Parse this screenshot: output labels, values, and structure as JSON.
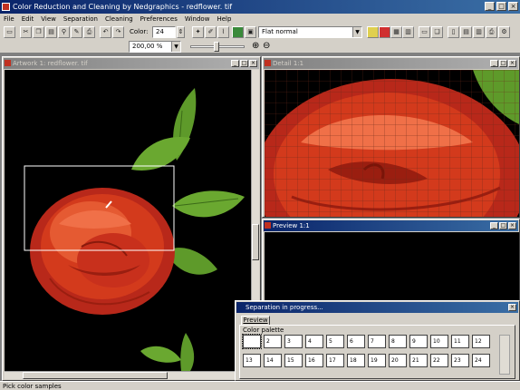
{
  "app": {
    "title": "Color Reduction and Cleaning by Nedgraphics - redflower. tif"
  },
  "menu": [
    "File",
    "Edit",
    "View",
    "Separation",
    "Cleaning",
    "Preferences",
    "Window",
    "Help"
  ],
  "toolbar": {
    "color_label": "Color:",
    "color_value": "24",
    "mode_value": "Flat normal",
    "zoom_value": "200,00 %"
  },
  "windows": {
    "artwork": {
      "title": "Artwork 1: redflower. tif"
    },
    "detail": {
      "title": "Detail 1:1"
    },
    "preview": {
      "title": "Preview 1:1"
    }
  },
  "dialog": {
    "title": "Separation in progress...",
    "tab": "Preview",
    "section_label": "Color palette",
    "swatches": [
      "",
      "2",
      "3",
      "4",
      "5",
      "6",
      "7",
      "8",
      "9",
      "10",
      "11",
      "12",
      "13",
      "14",
      "15",
      "16",
      "17",
      "18",
      "19",
      "20",
      "21",
      "22",
      "23",
      "24"
    ]
  },
  "status": {
    "text": "Pick color samples"
  },
  "colors": {
    "title_active": "#0a246a",
    "title_inactive": "#808080",
    "face": "#d4d0c8",
    "flower": "#d33a1c",
    "leaf": "#5e9a2a"
  }
}
